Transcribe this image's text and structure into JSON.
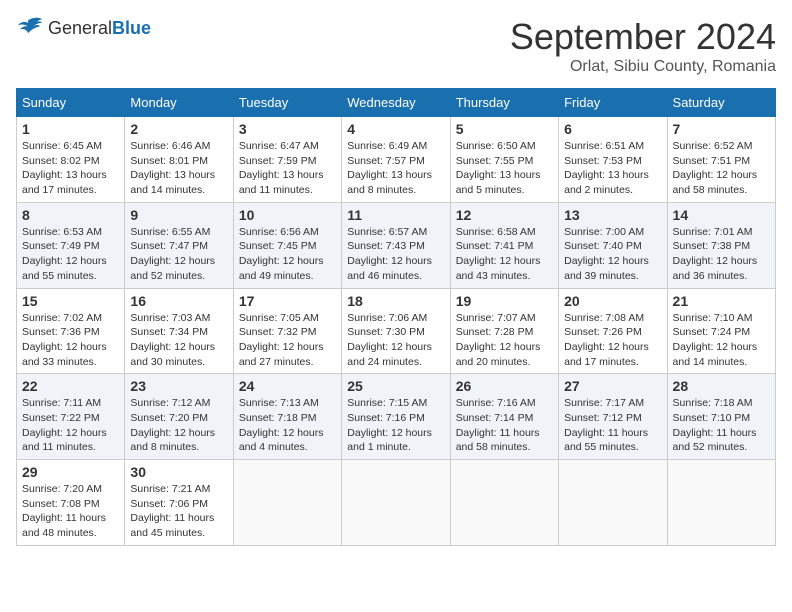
{
  "header": {
    "logo_general": "General",
    "logo_blue": "Blue",
    "month_title": "September 2024",
    "location": "Orlat, Sibiu County, Romania"
  },
  "calendar": {
    "days_of_week": [
      "Sunday",
      "Monday",
      "Tuesday",
      "Wednesday",
      "Thursday",
      "Friday",
      "Saturday"
    ],
    "weeks": [
      [
        {
          "day": 1,
          "sunrise": "6:45 AM",
          "sunset": "8:02 PM",
          "daylight": "13 hours and 17 minutes."
        },
        {
          "day": 2,
          "sunrise": "6:46 AM",
          "sunset": "8:01 PM",
          "daylight": "13 hours and 14 minutes."
        },
        {
          "day": 3,
          "sunrise": "6:47 AM",
          "sunset": "7:59 PM",
          "daylight": "13 hours and 11 minutes."
        },
        {
          "day": 4,
          "sunrise": "6:49 AM",
          "sunset": "7:57 PM",
          "daylight": "13 hours and 8 minutes."
        },
        {
          "day": 5,
          "sunrise": "6:50 AM",
          "sunset": "7:55 PM",
          "daylight": "13 hours and 5 minutes."
        },
        {
          "day": 6,
          "sunrise": "6:51 AM",
          "sunset": "7:53 PM",
          "daylight": "13 hours and 2 minutes."
        },
        {
          "day": 7,
          "sunrise": "6:52 AM",
          "sunset": "7:51 PM",
          "daylight": "12 hours and 58 minutes."
        }
      ],
      [
        {
          "day": 8,
          "sunrise": "6:53 AM",
          "sunset": "7:49 PM",
          "daylight": "12 hours and 55 minutes."
        },
        {
          "day": 9,
          "sunrise": "6:55 AM",
          "sunset": "7:47 PM",
          "daylight": "12 hours and 52 minutes."
        },
        {
          "day": 10,
          "sunrise": "6:56 AM",
          "sunset": "7:45 PM",
          "daylight": "12 hours and 49 minutes."
        },
        {
          "day": 11,
          "sunrise": "6:57 AM",
          "sunset": "7:43 PM",
          "daylight": "12 hours and 46 minutes."
        },
        {
          "day": 12,
          "sunrise": "6:58 AM",
          "sunset": "7:41 PM",
          "daylight": "12 hours and 43 minutes."
        },
        {
          "day": 13,
          "sunrise": "7:00 AM",
          "sunset": "7:40 PM",
          "daylight": "12 hours and 39 minutes."
        },
        {
          "day": 14,
          "sunrise": "7:01 AM",
          "sunset": "7:38 PM",
          "daylight": "12 hours and 36 minutes."
        }
      ],
      [
        {
          "day": 15,
          "sunrise": "7:02 AM",
          "sunset": "7:36 PM",
          "daylight": "12 hours and 33 minutes."
        },
        {
          "day": 16,
          "sunrise": "7:03 AM",
          "sunset": "7:34 PM",
          "daylight": "12 hours and 30 minutes."
        },
        {
          "day": 17,
          "sunrise": "7:05 AM",
          "sunset": "7:32 PM",
          "daylight": "12 hours and 27 minutes."
        },
        {
          "day": 18,
          "sunrise": "7:06 AM",
          "sunset": "7:30 PM",
          "daylight": "12 hours and 24 minutes."
        },
        {
          "day": 19,
          "sunrise": "7:07 AM",
          "sunset": "7:28 PM",
          "daylight": "12 hours and 20 minutes."
        },
        {
          "day": 20,
          "sunrise": "7:08 AM",
          "sunset": "7:26 PM",
          "daylight": "12 hours and 17 minutes."
        },
        {
          "day": 21,
          "sunrise": "7:10 AM",
          "sunset": "7:24 PM",
          "daylight": "12 hours and 14 minutes."
        }
      ],
      [
        {
          "day": 22,
          "sunrise": "7:11 AM",
          "sunset": "7:22 PM",
          "daylight": "12 hours and 11 minutes."
        },
        {
          "day": 23,
          "sunrise": "7:12 AM",
          "sunset": "7:20 PM",
          "daylight": "12 hours and 8 minutes."
        },
        {
          "day": 24,
          "sunrise": "7:13 AM",
          "sunset": "7:18 PM",
          "daylight": "12 hours and 4 minutes."
        },
        {
          "day": 25,
          "sunrise": "7:15 AM",
          "sunset": "7:16 PM",
          "daylight": "12 hours and 1 minute."
        },
        {
          "day": 26,
          "sunrise": "7:16 AM",
          "sunset": "7:14 PM",
          "daylight": "11 hours and 58 minutes."
        },
        {
          "day": 27,
          "sunrise": "7:17 AM",
          "sunset": "7:12 PM",
          "daylight": "11 hours and 55 minutes."
        },
        {
          "day": 28,
          "sunrise": "7:18 AM",
          "sunset": "7:10 PM",
          "daylight": "11 hours and 52 minutes."
        }
      ],
      [
        {
          "day": 29,
          "sunrise": "7:20 AM",
          "sunset": "7:08 PM",
          "daylight": "11 hours and 48 minutes."
        },
        {
          "day": 30,
          "sunrise": "7:21 AM",
          "sunset": "7:06 PM",
          "daylight": "11 hours and 45 minutes."
        },
        null,
        null,
        null,
        null,
        null
      ]
    ]
  }
}
